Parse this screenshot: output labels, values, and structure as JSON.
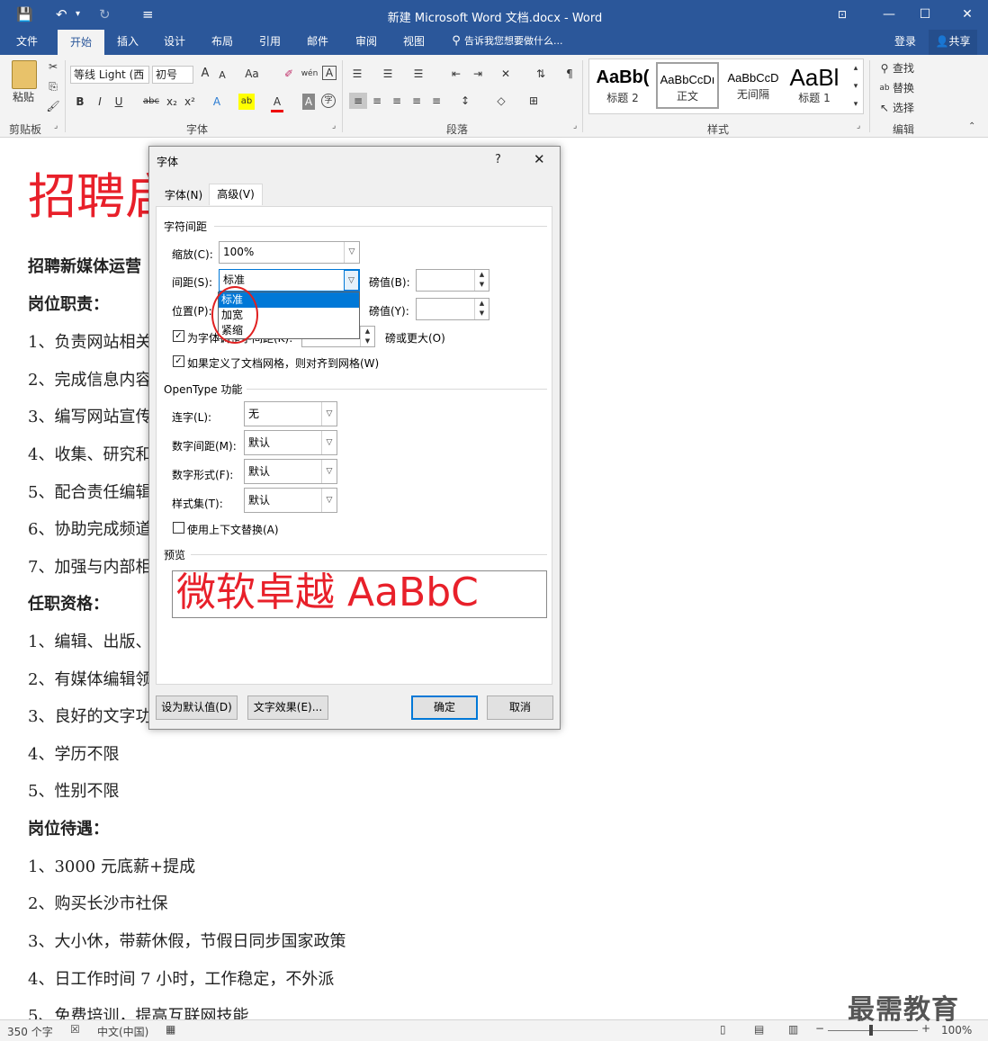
{
  "app": {
    "title": "新建 Microsoft Word 文档.docx - Word"
  },
  "qat": {
    "save": "💾",
    "undo": "↶",
    "undo_drop": "▾",
    "redo": "↻",
    "customize": "≡"
  },
  "window": {
    "ribbon_opts": "⊡",
    "minimize": "—",
    "maximize": "☐",
    "close": "✕"
  },
  "tabs": {
    "items": [
      "文件",
      "开始",
      "插入",
      "设计",
      "布局",
      "引用",
      "邮件",
      "审阅",
      "视图"
    ],
    "active": "开始",
    "tell_me": "告诉我您想要做什么...",
    "signin": "登录",
    "share": "共享"
  },
  "ribbon": {
    "clipboard": {
      "paste": "粘贴",
      "group": "剪贴板"
    },
    "font": {
      "name": "等线 Light (西",
      "size": "初号",
      "grow": "A",
      "shrink": "A",
      "case": "Aa",
      "clear": "✐",
      "phonetic": "wén",
      "border": "A",
      "bold": "B",
      "italic": "I",
      "underline": "U",
      "strike": "abc",
      "sub": "x₂",
      "sup": "x²",
      "effects": "A",
      "highlight": "ab",
      "color": "A",
      "shade": "A",
      "enclose": "字",
      "group": "字体"
    },
    "paragraph": {
      "group": "段落"
    },
    "styles": {
      "items": [
        {
          "sample": "AaBb(",
          "name": "标题 2"
        },
        {
          "sample": "AaBbCcDı",
          "name": "正文"
        },
        {
          "sample": "AaBbCcD",
          "name": "无间隔"
        },
        {
          "sample": "AaBl",
          "name": "标题 1"
        }
      ],
      "group": "样式"
    },
    "editing": {
      "find": "查找",
      "replace": "替换",
      "select": "选择",
      "group": "编辑"
    }
  },
  "document": {
    "title": "招聘启",
    "lines": [
      "招聘新媒体运营",
      "岗位职责：",
      "1、负责网站相关",
      "2、完成信息内容",
      "3、编写网站宣传",
      "4、收集、研究和",
      "5、配合责任编辑",
      "6、协助完成频道",
      "7、加强与内部相",
      "任职资格：",
      "1、编辑、出版、",
      "2、有媒体编辑领",
      "3、良好的文字功",
      "4、学历不限",
      "5、性别不限",
      "岗位待遇：",
      "1、3000 元底薪+提成",
      "2、购买长沙市社保",
      "3、大小休，带薪休假，节假日同步国家政策",
      "4、日工作时间 7 小时，工作稳定，不外派",
      "5、免费培训，提高互联网技能"
    ]
  },
  "dialog": {
    "title": "字体",
    "help": "?",
    "close": "✕",
    "tabs": [
      "字体(N)",
      "高级(V)"
    ],
    "spacing_section": "字符间距",
    "scale_label": "缩放(C):",
    "scale_value": "100%",
    "spacing_label": "间距(S):",
    "spacing_value": "标准",
    "pound_b_label": "磅值(B):",
    "position_label": "位置(P):",
    "pound_y_label": "磅值(Y):",
    "kerning_label": "为字体调整字间距(K):",
    "kerning_checked": true,
    "kerning_suffix": "磅或更大(O)",
    "grid_label": "如果定义了文档网格，则对齐到网格(W)",
    "grid_checked": true,
    "opentype_section": "OpenType 功能",
    "ligature_label": "连字(L):",
    "ligature_value": "无",
    "numspacing_label": "数字间距(M):",
    "numspacing_value": "默认",
    "numform_label": "数字形式(F):",
    "numform_value": "默认",
    "styleset_label": "样式集(T):",
    "styleset_value": "默认",
    "contextual_label": "使用上下文替换(A)",
    "contextual_checked": false,
    "preview_section": "预览",
    "preview_text": "微软卓越 AaBbC",
    "btn_default": "设为默认值(D)",
    "btn_effects": "文字效果(E)...",
    "btn_ok": "确定",
    "btn_cancel": "取消",
    "dropdown_options": [
      "标准",
      "加宽",
      "紧缩"
    ],
    "dropdown_selected": "标准"
  },
  "status": {
    "words": "350 个字",
    "lang": "中文(中国)",
    "zoom": "100%"
  },
  "watermark": "最需教育"
}
